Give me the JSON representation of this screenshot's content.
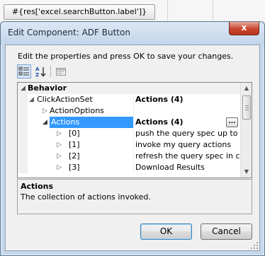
{
  "background": {
    "button_label": "#{res['excel.searchButton.label']}"
  },
  "dialog": {
    "title": "Edit Component: ADF Button",
    "close_glyph": "x",
    "intro": "Edit the properties and press OK to save your changes.",
    "toolbar": {
      "categorized_icon": "categorized-icon",
      "alphabetical_icon": "sort-az-icon",
      "property_pages_icon": "property-pages-icon"
    },
    "grid": {
      "category": {
        "label": "Behavior",
        "expander": "◢"
      },
      "rows": [
        {
          "name": "ClickActionSet",
          "value": "Actions (4)",
          "expander": "◢",
          "value_bold": true
        },
        {
          "name": "ActionOptions",
          "value": "",
          "expander": "▷"
        },
        {
          "name": "Actions",
          "value": "Actions (4)",
          "expander": "◢",
          "value_bold": true,
          "selected": true,
          "button": "..."
        },
        {
          "name": "[0]",
          "value": "push the query spec up to the s",
          "expander": "▷"
        },
        {
          "name": "[1]",
          "value": "invoke my query actions",
          "expander": "▷"
        },
        {
          "name": "[2]",
          "value": "refresh the query spec in case t",
          "expander": "▷"
        },
        {
          "name": "[3]",
          "value": "Download Results",
          "expander": "▷"
        }
      ],
      "scroll_up": "▲",
      "scroll_down": "▼"
    },
    "description": {
      "title": "Actions",
      "text": "The collection of actions invoked."
    },
    "buttons": {
      "ok": "OK",
      "cancel": "Cancel"
    },
    "colors": {
      "selection": "#3399ff",
      "frame": "#c6d7ec",
      "close": "#c9452d"
    }
  }
}
